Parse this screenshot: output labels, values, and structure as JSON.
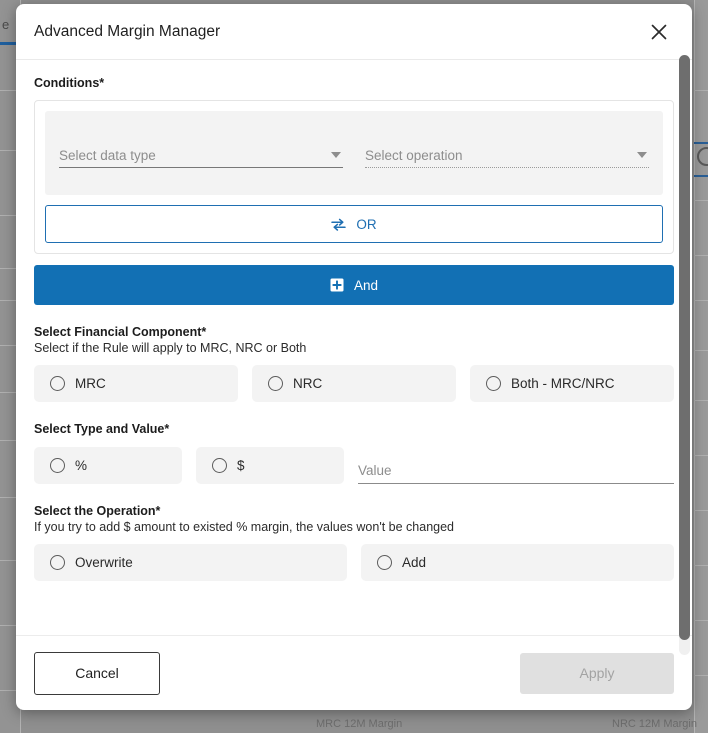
{
  "background": {
    "edge_letter": "e",
    "bottom_labels": [
      {
        "text": "MRC 12M Margin"
      },
      {
        "text": "NRC 12M Margin"
      }
    ]
  },
  "modal": {
    "title": "Advanced Margin Manager",
    "close_icon": "close-icon",
    "conditions": {
      "label": "Conditions*",
      "data_type_select": {
        "placeholder": "Select data type",
        "value": "",
        "state": "enabled"
      },
      "operation_select": {
        "placeholder": "Select operation",
        "value": "",
        "state": "disabled"
      },
      "or_button": {
        "label": "OR",
        "icon": "swap-horizontal-icon"
      },
      "and_button": {
        "label": "And",
        "icon": "plus-box-icon"
      }
    },
    "financial_component": {
      "label": "Select Financial Component*",
      "hint": "Select if the Rule will apply to MRC, NRC or Both",
      "options": [
        {
          "label": "MRC",
          "selected": false
        },
        {
          "label": "NRC",
          "selected": false
        },
        {
          "label": "Both - MRC/NRC",
          "selected": false
        }
      ]
    },
    "type_and_value": {
      "label": "Select Type and Value*",
      "options": [
        {
          "label": "%",
          "selected": false
        },
        {
          "label": "$",
          "selected": false
        }
      ],
      "value_input": {
        "placeholder": "Value",
        "value": ""
      }
    },
    "operation": {
      "label": "Select the Operation*",
      "hint": "If you try to add $ amount to existed % margin, the values won't be changed",
      "options": [
        {
          "label": "Overwrite",
          "selected": false
        },
        {
          "label": "Add",
          "selected": false
        }
      ]
    },
    "footer": {
      "cancel_label": "Cancel",
      "apply_label": "Apply",
      "apply_enabled": false
    }
  },
  "colors": {
    "primary_blue": "#1270b4",
    "or_border_blue": "#1f6fb2",
    "panel_gray": "#f3f3f3",
    "disabled_gray": "#e0e0e0",
    "backdrop": "#8f8f8f"
  }
}
